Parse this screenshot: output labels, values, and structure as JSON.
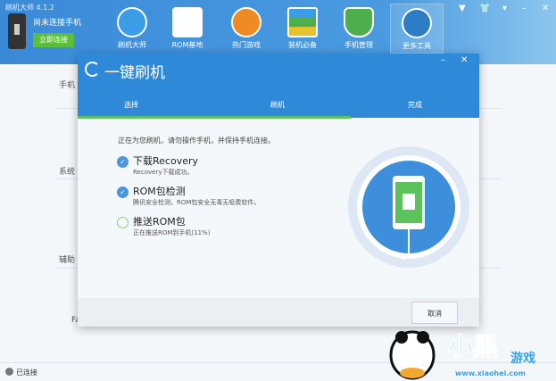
{
  "app": {
    "title": "刷机大师 4.1.2",
    "phone_status": "尚未连接手机",
    "connect_button": "立即连接"
  },
  "nav": [
    {
      "label": "刷机大师",
      "color": "#3b9de6"
    },
    {
      "label": "ROM基地",
      "color": "#8cc152"
    },
    {
      "label": "热门游戏",
      "color": "#f08a24"
    },
    {
      "label": "装机必备",
      "color": "#3aaa6b"
    },
    {
      "label": "手机管理",
      "color": "#4cae4c"
    },
    {
      "label": "更多工具",
      "color": "#2d7cc6"
    }
  ],
  "background": {
    "sections": [
      "手机",
      "系统",
      "辅助"
    ],
    "item": "Fa"
  },
  "dialog": {
    "title": "一键刷机",
    "tabs": [
      "选择",
      "刷机",
      "完成"
    ],
    "progress_percent": 68,
    "intro": "正在为您刷机，请勿操作手机，并保持手机连接。",
    "steps": [
      {
        "title": "下载Recovery",
        "subtitle": "Recovery下载成功。",
        "state": "done"
      },
      {
        "title": "ROM包检测",
        "subtitle": "腾讯安全检测，ROM包安全无毒无吸费软件。",
        "state": "done"
      },
      {
        "title": "推送ROM包",
        "subtitle": "正在推送ROM到手机(11%)",
        "state": "running"
      }
    ],
    "cancel": "取消"
  },
  "statusbar": {
    "text": "已连接"
  },
  "watermark": {
    "text": "小黑游戏",
    "url": "www.xiaohei.com"
  }
}
